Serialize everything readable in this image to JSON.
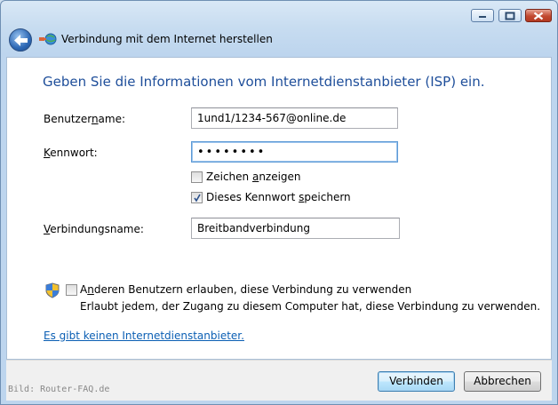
{
  "window": {
    "title": "Verbindung mit dem Internet herstellen",
    "controls": {
      "minimize_icon": "minimize-icon",
      "maximize_icon": "maximize-icon",
      "close_icon": "close-icon"
    }
  },
  "content": {
    "heading": "Geben Sie die Informationen vom Internetdienstanbieter (ISP) ein.",
    "username": {
      "label_pre": "Benutzer",
      "label_key": "n",
      "label_post": "ame:",
      "value": "1und1/1234-567@online.de"
    },
    "password": {
      "label_pre": "",
      "label_key": "K",
      "label_post": "ennwort:",
      "value": "••••••••"
    },
    "show_chars": {
      "label_pre": "Zeichen ",
      "label_key": "a",
      "label_post": "nzeigen",
      "checked": false
    },
    "save_password": {
      "label_pre": "Dieses Kennwort ",
      "label_key": "s",
      "label_post": "peichern",
      "checked": true
    },
    "connection_name": {
      "label_pre": "",
      "label_key": "V",
      "label_post": "erbindungsname:",
      "value": "Breitbandverbindung"
    },
    "allow_others": {
      "label_pre": "A",
      "label_key": "n",
      "label_post": "deren Benutzern erlauben, diese Verbindung zu verwenden",
      "checked": false,
      "description": "Erlaubt jedem, der Zugang zu diesem Computer hat, diese Verbindung zu verwenden."
    },
    "no_isp_link": "Es gibt keinen Internetdienstanbieter."
  },
  "footer": {
    "credit": "Bild: Router-FAQ.de",
    "connect_button": "Verbinden",
    "cancel_button": "Abbrechen"
  },
  "colors": {
    "heading": "#1e4e9a",
    "link": "#0b5fb4",
    "close": "#c24930"
  }
}
